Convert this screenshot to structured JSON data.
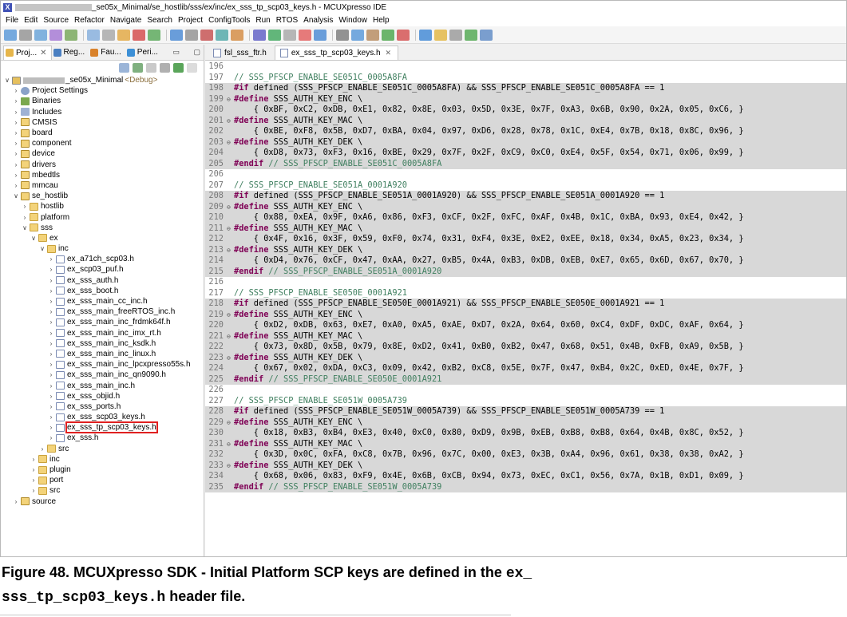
{
  "window": {
    "title": "_se05x_Minimal/se_hostlib/sss/ex/inc/ex_sss_tp_scp03_keys.h - MCUXpresso IDE"
  },
  "menu": [
    "File",
    "Edit",
    "Source",
    "Refactor",
    "Navigate",
    "Search",
    "Project",
    "ConfigTools",
    "Run",
    "RTOS",
    "Analysis",
    "Window",
    "Help"
  ],
  "left_tabs": [
    "Proj...",
    "Reg...",
    "Fau...",
    "Peri..."
  ],
  "tree": {
    "root_label": "_se05x_Minimal",
    "root_suffix": "<Debug>",
    "items": [
      "Project Settings",
      "Binaries",
      "Includes",
      "CMSIS",
      "board",
      "component",
      "device",
      "drivers",
      "mbedtls",
      "mmcau",
      "se_hostlib",
      "hostlib",
      "platform",
      "sss",
      "ex",
      "inc",
      "ex_a71ch_scp03.h",
      "ex_scp03_puf.h",
      "ex_sss_auth.h",
      "ex_sss_boot.h",
      "ex_sss_main_cc_inc.h",
      "ex_sss_main_freeRTOS_inc.h",
      "ex_sss_main_inc_frdmk64f.h",
      "ex_sss_main_inc_imx_rt.h",
      "ex_sss_main_inc_ksdk.h",
      "ex_sss_main_inc_linux.h",
      "ex_sss_main_inc_lpcxpresso55s.h",
      "ex_sss_main_inc_qn9090.h",
      "ex_sss_main_inc.h",
      "ex_sss_objid.h",
      "ex_sss_ports.h",
      "ex_sss_scp03_keys.h",
      "ex_sss_tp_scp03_keys.h",
      "ex_sss.h",
      "src",
      "inc",
      "plugin",
      "port",
      "src",
      "source"
    ]
  },
  "editor_tabs": [
    "fsl_sss_ftr.h",
    "ex_sss_tp_scp03_keys.h"
  ],
  "code": {
    "line_numbers": [
      "196",
      "197",
      "198",
      "199",
      "200",
      "201",
      "202",
      "203",
      "204",
      "205",
      "206",
      "207",
      "208",
      "209",
      "210",
      "211",
      "212",
      "213",
      "214",
      "215",
      "216",
      "217",
      "218",
      "219",
      "220",
      "221",
      "222",
      "223",
      "224",
      "225",
      "226",
      "227",
      "228",
      "229",
      "230",
      "231",
      "232",
      "233",
      "234",
      "235"
    ],
    "lines": [
      "",
      "// SSS_PFSCP_ENABLE_SE051C_0005A8FA",
      "#if defined (SSS_PFSCP_ENABLE_SE051C_0005A8FA) && SSS_PFSCP_ENABLE_SE051C_0005A8FA == 1",
      "#define SSS_AUTH_KEY_ENC \\",
      "    { 0xBF, 0xC2, 0xDB, 0xE1, 0x82, 0x8E, 0x03, 0x5D, 0x3E, 0x7F, 0xA3, 0x6B, 0x90, 0x2A, 0x05, 0xC6, }",
      "#define SSS_AUTH_KEY_MAC \\",
      "    { 0xBE, 0xF8, 0x5B, 0xD7, 0xBA, 0x04, 0x97, 0xD6, 0x28, 0x78, 0x1C, 0xE4, 0x7B, 0x18, 0x8C, 0x96, }",
      "#define SSS_AUTH_KEY_DEK \\",
      "    { 0xD8, 0x73, 0xF3, 0x16, 0xBE, 0x29, 0x7F, 0x2F, 0xC9, 0xC0, 0xE4, 0x5F, 0x54, 0x71, 0x06, 0x99, }",
      "#endif // SSS_PFSCP_ENABLE_SE051C_0005A8FA",
      "",
      "// SSS_PFSCP_ENABLE_SE051A_0001A920",
      "#if defined (SSS_PFSCP_ENABLE_SE051A_0001A920) && SSS_PFSCP_ENABLE_SE051A_0001A920 == 1",
      "#define SSS_AUTH_KEY_ENC \\",
      "    { 0x88, 0xEA, 0x9F, 0xA6, 0x86, 0xF3, 0xCF, 0x2F, 0xFC, 0xAF, 0x4B, 0x1C, 0xBA, 0x93, 0xE4, 0x42, }",
      "#define SSS_AUTH_KEY_MAC \\",
      "    { 0x4F, 0x16, 0x3F, 0x59, 0xF0, 0x74, 0x31, 0xF4, 0x3E, 0xE2, 0xEE, 0x18, 0x34, 0xA5, 0x23, 0x34, }",
      "#define SSS_AUTH_KEY_DEK \\",
      "    { 0xD4, 0x76, 0xCF, 0x47, 0xAA, 0x27, 0xB5, 0x4A, 0xB3, 0xDB, 0xEB, 0xE7, 0x65, 0x6D, 0x67, 0x70, }",
      "#endif // SSS_PFSCP_ENABLE_SE051A_0001A920",
      "",
      "// SSS_PFSCP_ENABLE_SE050E_0001A921",
      "#if defined (SSS_PFSCP_ENABLE_SE050E_0001A921) && SSS_PFSCP_ENABLE_SE050E_0001A921 == 1",
      "#define SSS_AUTH_KEY_ENC \\",
      "    { 0xD2, 0xDB, 0x63, 0xE7, 0xA0, 0xA5, 0xAE, 0xD7, 0x2A, 0x64, 0x60, 0xC4, 0xDF, 0xDC, 0xAF, 0x64, }",
      "#define SSS_AUTH_KEY_MAC \\",
      "    { 0x73, 0x8D, 0x5B, 0x79, 0x8E, 0xD2, 0x41, 0xB0, 0xB2, 0x47, 0x68, 0x51, 0x4B, 0xFB, 0xA9, 0x5B, }",
      "#define SSS_AUTH_KEY_DEK \\",
      "    { 0x67, 0x02, 0xDA, 0xC3, 0x09, 0x42, 0xB2, 0xC8, 0x5E, 0x7F, 0x47, 0xB4, 0x2C, 0xED, 0x4E, 0x7F, }",
      "#endif // SSS_PFSCP_ENABLE_SE050E_0001A921",
      "",
      "// SSS_PFSCP_ENABLE_SE051W_0005A739",
      "#if defined (SSS_PFSCP_ENABLE_SE051W_0005A739) && SSS_PFSCP_ENABLE_SE051W_0005A739 == 1",
      "#define SSS_AUTH_KEY_ENC \\",
      "    { 0x18, 0xB3, 0xB4, 0xE3, 0x40, 0xC0, 0x80, 0xD9, 0x9B, 0xEB, 0xB8, 0xB8, 0x64, 0x4B, 0x8C, 0x52, }",
      "#define SSS_AUTH_KEY_MAC \\",
      "    { 0x3D, 0x0C, 0xFA, 0xC8, 0x7B, 0x96, 0x7C, 0x00, 0xE3, 0x3B, 0xA4, 0x96, 0x61, 0x38, 0x38, 0xA2, }",
      "#define SSS_AUTH_KEY_DEK \\",
      "    { 0x68, 0x06, 0x83, 0xF9, 0x4E, 0x6B, 0xCB, 0x94, 0x73, 0xEC, 0xC1, 0x56, 0x7A, 0x1B, 0xD1, 0x09, }",
      "#endif // SSS_PFSCP_ENABLE_SE051W_0005A739"
    ]
  },
  "caption": {
    "prefix": "Figure 48.  MCUXpresso SDK - Initial Platform SCP keys are defined in the ",
    "code_line1": "ex_",
    "code_line2": "sss_tp_scp03_keys.h",
    "suffix": " header file."
  },
  "colors": {
    "comment": "#3f7f5f",
    "directive": "#7f0055",
    "highlight": "#d8d8d8",
    "selection_outline": "#e02020"
  }
}
